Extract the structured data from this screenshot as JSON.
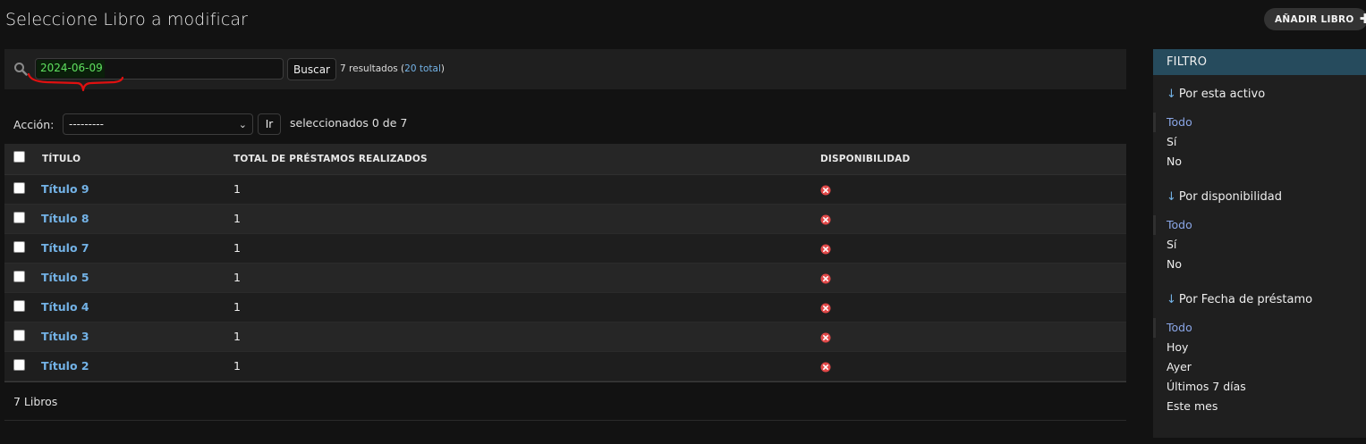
{
  "header": {
    "title": "Seleccione Libro a modificar",
    "add_button_label": "AÑADIR LIBRO",
    "add_icon": "plus-icon"
  },
  "search": {
    "value": "2024-06-09",
    "button_label": "Buscar",
    "result_text": "7 resultados (",
    "total_link": "20 total",
    "result_close": ")",
    "annotation_color": "#e01010",
    "highlight_text_color": "#5fe05f"
  },
  "actions": {
    "label": "Acción:",
    "selected": "---------",
    "go_label": "Ir",
    "counter": "seleccionados 0 de 7"
  },
  "table": {
    "columns": [
      "TÍTULO",
      "TOTAL DE PRÉSTAMOS REALIZADOS",
      "DISPONIBILIDAD"
    ],
    "rows": [
      {
        "title": "Título 9",
        "total": "1",
        "available": false
      },
      {
        "title": "Título 8",
        "total": "1",
        "available": false
      },
      {
        "title": "Título 7",
        "total": "1",
        "available": false
      },
      {
        "title": "Título 5",
        "total": "1",
        "available": false
      },
      {
        "title": "Título 4",
        "total": "1",
        "available": false
      },
      {
        "title": "Título 3",
        "total": "1",
        "available": false
      },
      {
        "title": "Título 2",
        "total": "1",
        "available": false
      }
    ],
    "status_icon": "no-icon",
    "status_color": "#e04848"
  },
  "paginator": {
    "text": "7 Libros"
  },
  "filter": {
    "header": "FILTRO",
    "groups": [
      {
        "title": "Por esta activo",
        "options": [
          "Todo",
          "Sí",
          "No"
        ],
        "selected": "Todo"
      },
      {
        "title": "Por disponibilidad",
        "options": [
          "Todo",
          "Sí",
          "No"
        ],
        "selected": "Todo"
      },
      {
        "title": "Por Fecha de préstamo",
        "options": [
          "Todo",
          "Hoy",
          "Ayer",
          "Últimos 7 días",
          "Este mes"
        ],
        "selected": "Todo"
      }
    ]
  },
  "colors": {
    "background": "#121212",
    "link": "#73b2e6",
    "filter_header": "#264b5d",
    "selected_filter": "#8aa6e6"
  }
}
